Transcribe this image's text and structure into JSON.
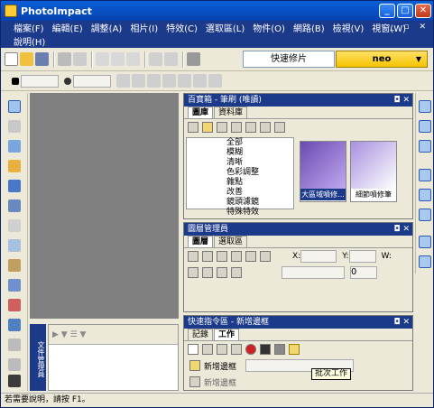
{
  "window": {
    "title": "PhotoImpact"
  },
  "menu": {
    "row1": [
      "檔案(F)",
      "編輯(E)",
      "調整(A)",
      "相片(I)",
      "特效(C)",
      "選取區(L)",
      "物件(O)",
      "網路(B)",
      "檢視(V)",
      "視窗(W)"
    ],
    "row2": [
      "說明(H)"
    ]
  },
  "toolbar": {
    "quick_label": "快速修片",
    "neo_label": "neo"
  },
  "easypalette": {
    "title": "百寶箱 - 筆刷 (唯讀)",
    "tabs": [
      "圖庫",
      "資料庫"
    ],
    "tree": [
      "全部",
      "模糊",
      "清晰",
      "色彩調整",
      "雜點",
      "改善",
      "鏡頭濾鏡",
      "特殊特效"
    ],
    "thumbs": [
      "大區域噴修...",
      "細節噴修筆"
    ]
  },
  "layer_manager": {
    "title": "圖層管理員",
    "tabs": [
      "圖層",
      "選取區"
    ],
    "labels": {
      "x": "X:",
      "y": "Y:",
      "w": "W:"
    },
    "opacity": "0"
  },
  "quick_command": {
    "title": "快速指令區 - 新增邊框",
    "tabs": [
      "記錄",
      "工作"
    ],
    "task": "新增邊框",
    "tooltip": "批次工作",
    "row2": "新增邊框"
  },
  "document_manager": {
    "tab": "文件管理員"
  },
  "status": {
    "text": "若需要說明，請按 F1。"
  }
}
